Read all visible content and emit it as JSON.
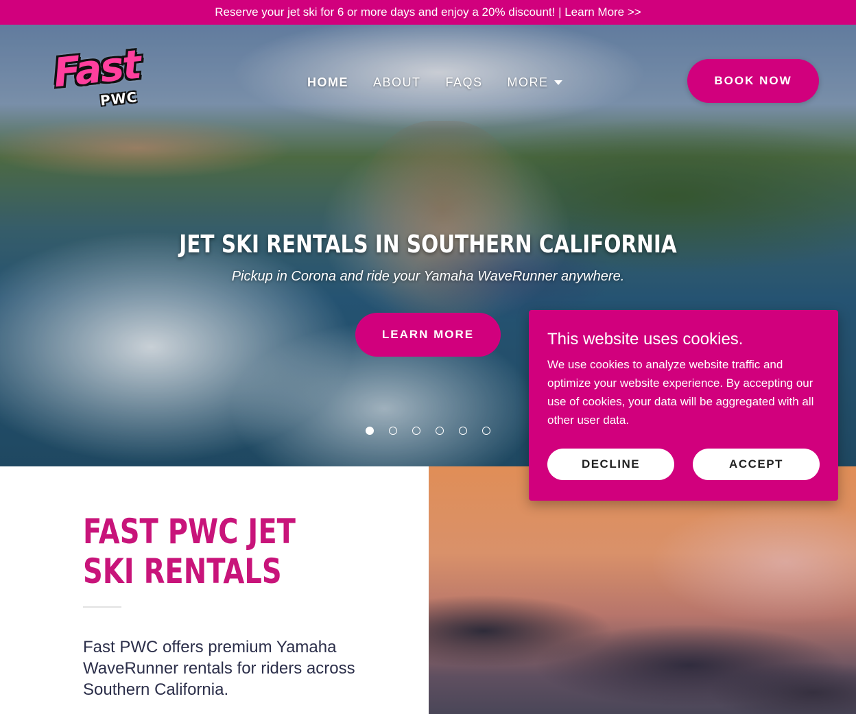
{
  "promo": {
    "text": "Reserve your jet ski for 6 or more days and enjoy a 20% discount! | Learn More >>"
  },
  "brand": {
    "logo_main": "Fast",
    "logo_sub": "PWC",
    "accent": "#d1007d",
    "heading_color": "#c8147a"
  },
  "nav": {
    "items": [
      {
        "label": "HOME",
        "active": true
      },
      {
        "label": "ABOUT"
      },
      {
        "label": "FAQS"
      },
      {
        "label": "MORE",
        "has_dropdown": true,
        "icon": "chevron-down-icon"
      }
    ],
    "book_label": "BOOK NOW"
  },
  "hero": {
    "title": "JET SKI RENTALS IN SOUTHERN CALIFORNIA",
    "subtitle": "Pickup in Corona and ride your Yamaha WaveRunner anywhere.",
    "cta_label": "LEARN MORE",
    "slide_count": 6,
    "active_slide": 1
  },
  "intro": {
    "title": "FAST PWC JET SKI RENTALS",
    "body": "Fast PWC offers premium Yamaha WaveRunner rentals for riders across Southern California."
  },
  "cookie": {
    "title": "This website uses cookies.",
    "text": "We use cookies to analyze website traffic and optimize your website experience. By accepting our use of cookies, your data will be aggregated with all other user data.",
    "decline_label": "DECLINE",
    "accept_label": "ACCEPT"
  }
}
